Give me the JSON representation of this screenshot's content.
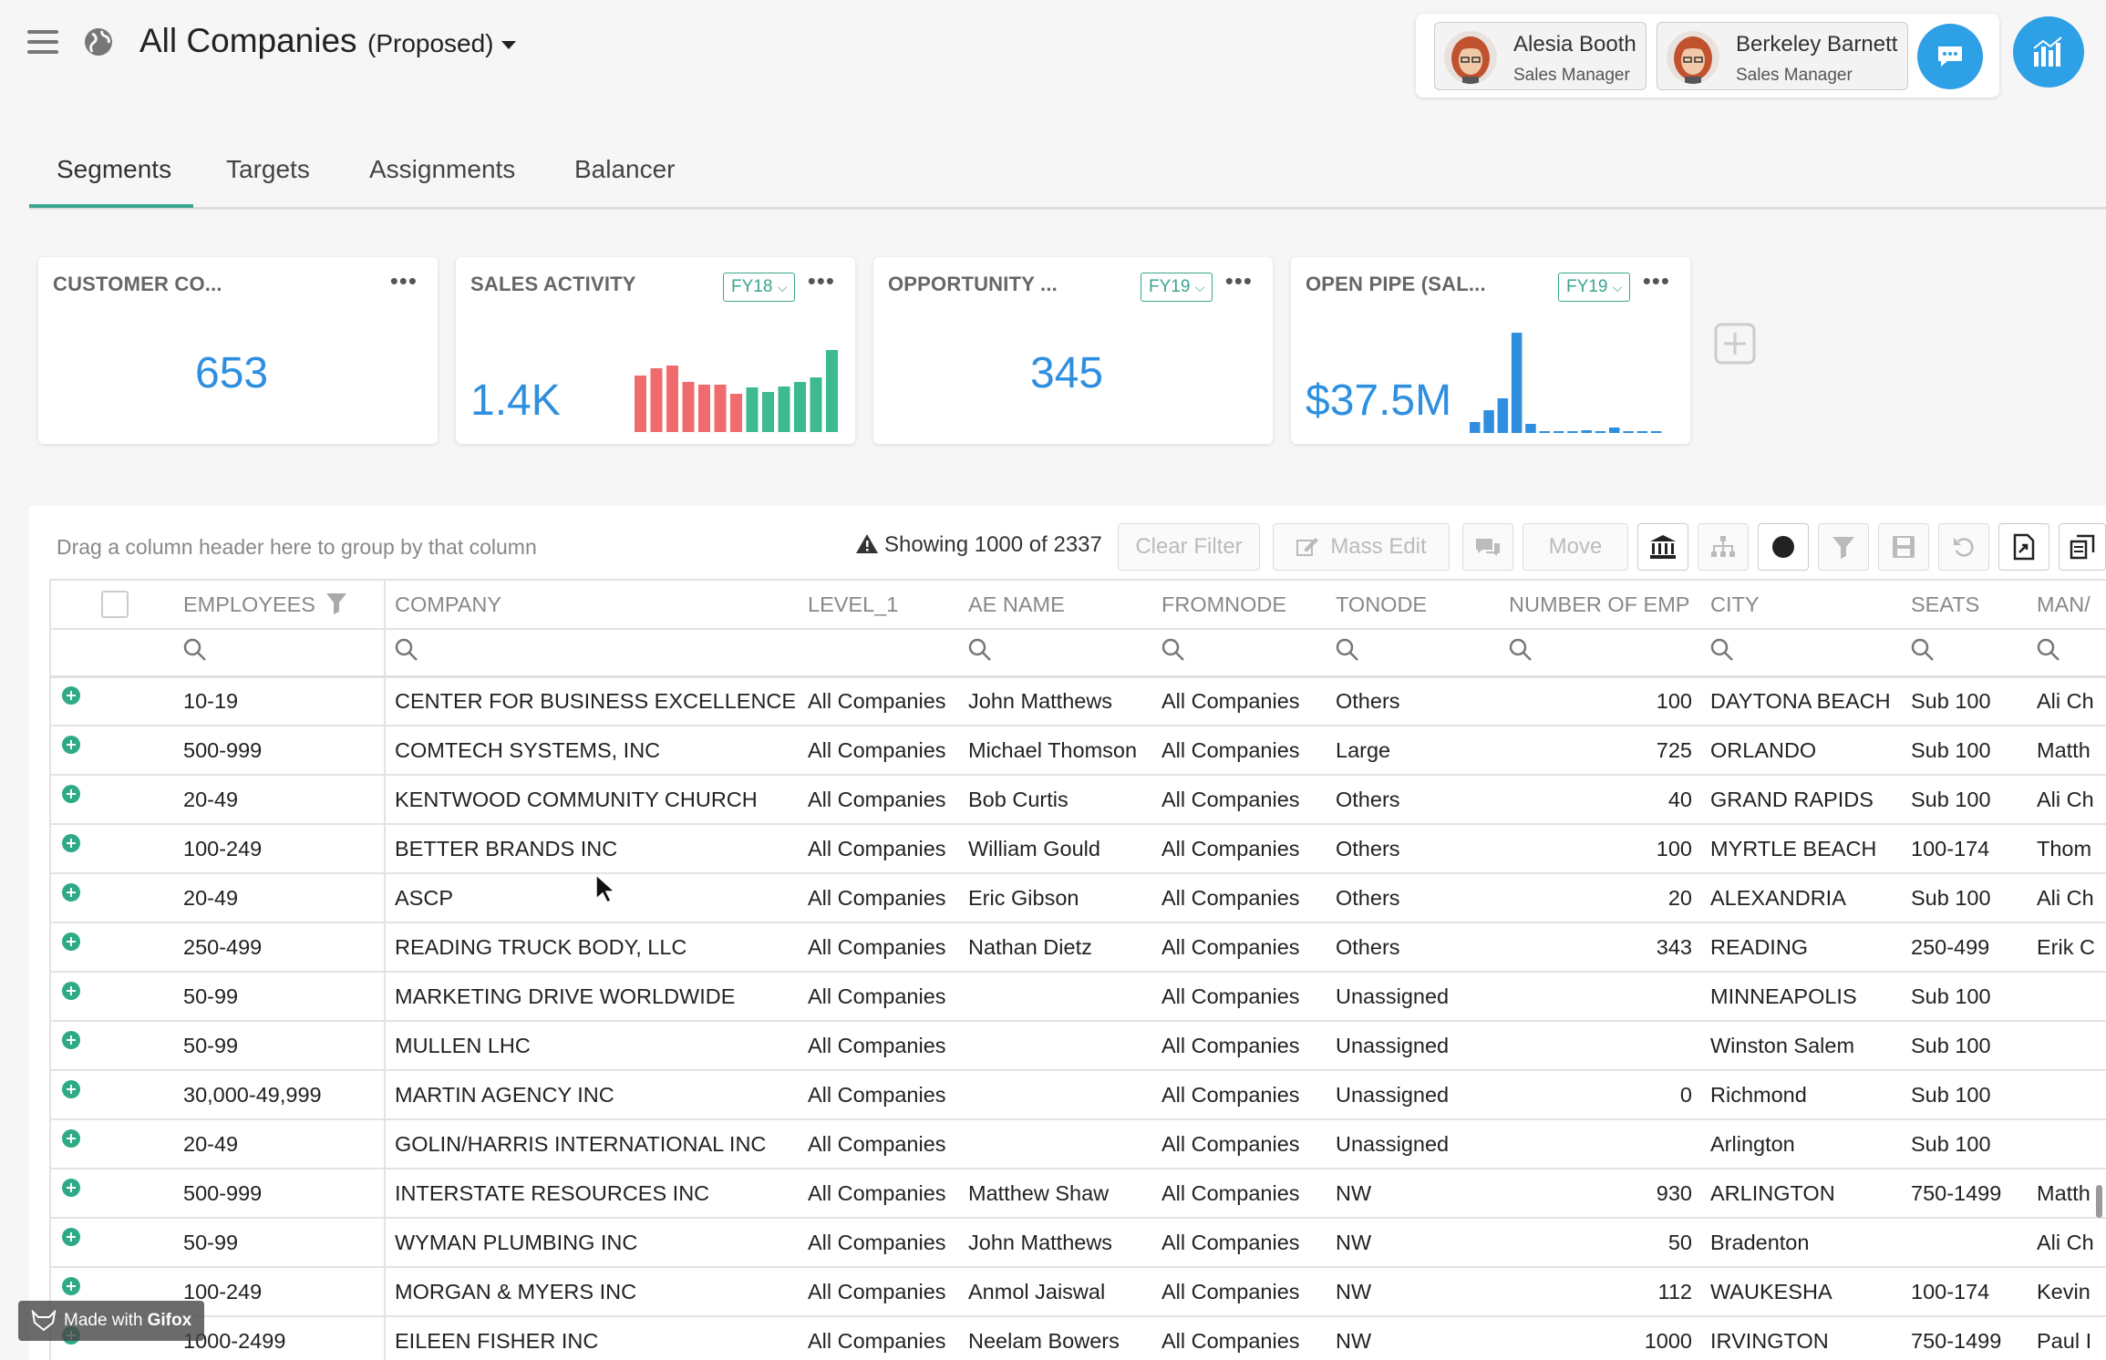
{
  "header": {
    "title": "All Companies",
    "scenario": "(Proposed)",
    "users": [
      {
        "name": "Alesia Booth",
        "role": "Sales Manager"
      },
      {
        "name": "Berkeley Barnett",
        "role": "Sales Manager"
      }
    ]
  },
  "tabs": [
    "Segments",
    "Targets",
    "Assignments",
    "Balancer"
  ],
  "active_tab": "Segments",
  "cards": [
    {
      "title": "CUSTOMER CO...",
      "value": "653",
      "fy": ""
    },
    {
      "title": "SALES ACTIVITY",
      "value": "1.4K",
      "fy": "FY18"
    },
    {
      "title": "OPPORTUNITY ...",
      "value": "345",
      "fy": "FY19"
    },
    {
      "title": "OPEN PIPE (SAL...",
      "value": "$37.5M",
      "fy": "FY19"
    }
  ],
  "sparklines": {
    "sales_activity": {
      "colors": [
        "#f06b6b",
        "#f06b6b",
        "#f06b6b",
        "#f06b6b",
        "#f06b6b",
        "#f06b6b",
        "#f06b6b",
        "#3dbb8f",
        "#3dbb8f",
        "#3dbb8f",
        "#3dbb8f",
        "#3dbb8f",
        "#3dbb8f"
      ],
      "values": [
        62,
        70,
        73,
        55,
        52,
        52,
        42,
        49,
        44,
        50,
        55,
        60,
        90
      ]
    },
    "open_pipe": {
      "color": "#2e8fe0",
      "values": [
        12,
        25,
        38,
        110,
        10,
        1,
        1,
        1,
        3,
        1,
        6,
        1,
        1,
        1
      ]
    }
  },
  "toolbar": {
    "group_hint": "Drag a column header here to group by that column",
    "showing": "Showing 1000 of 2337",
    "clear_filter": "Clear Filter",
    "mass_edit": "Mass Edit",
    "move": "Move"
  },
  "table": {
    "columns": [
      "EMPLOYEES",
      "COMPANY",
      "LEVEL_1",
      "AE NAME",
      "FROMNODE",
      "TONODE",
      "NUMBER OF EMP",
      "CITY",
      "SEATS",
      "MAN/"
    ],
    "rows": [
      [
        "10-19",
        "CENTER FOR BUSINESS EXCELLENCE",
        "All Companies",
        "John Matthews",
        "All Companies",
        "Others",
        "100",
        "DAYTONA BEACH",
        "Sub 100",
        "Ali Ch"
      ],
      [
        "500-999",
        "COMTECH SYSTEMS, INC",
        "All Companies",
        "Michael Thomson",
        "All Companies",
        "Large",
        "725",
        "ORLANDO",
        "Sub 100",
        "Matth"
      ],
      [
        "20-49",
        "KENTWOOD COMMUNITY CHURCH",
        "All Companies",
        "Bob Curtis",
        "All Companies",
        "Others",
        "40",
        "GRAND RAPIDS",
        "Sub 100",
        "Ali Ch"
      ],
      [
        "100-249",
        "BETTER BRANDS INC",
        "All Companies",
        "William Gould",
        "All Companies",
        "Others",
        "100",
        "MYRTLE BEACH",
        "100-174",
        "Thom"
      ],
      [
        "20-49",
        "ASCP",
        "All Companies",
        "Eric Gibson",
        "All Companies",
        "Others",
        "20",
        "ALEXANDRIA",
        "Sub 100",
        "Ali Ch"
      ],
      [
        "250-499",
        "READING TRUCK BODY, LLC",
        "All Companies",
        "Nathan Dietz",
        "All Companies",
        "Others",
        "343",
        "READING",
        "250-499",
        "Erik C"
      ],
      [
        "50-99",
        "MARKETING DRIVE WORLDWIDE",
        "All Companies",
        "",
        "All Companies",
        "Unassigned",
        "",
        "MINNEAPOLIS",
        "Sub 100",
        ""
      ],
      [
        "50-99",
        "MULLEN LHC",
        "All Companies",
        "",
        "All Companies",
        "Unassigned",
        "",
        "Winston Salem",
        "Sub 100",
        ""
      ],
      [
        "30,000-49,999",
        "MARTIN AGENCY INC",
        "All Companies",
        "",
        "All Companies",
        "Unassigned",
        "0",
        "Richmond",
        "Sub 100",
        ""
      ],
      [
        "20-49",
        "GOLIN/HARRIS INTERNATIONAL INC",
        "All Companies",
        "",
        "All Companies",
        "Unassigned",
        "",
        "Arlington",
        "Sub 100",
        ""
      ],
      [
        "500-999",
        "INTERSTATE RESOURCES INC",
        "All Companies",
        "Matthew Shaw",
        "All Companies",
        "NW",
        "930",
        "ARLINGTON",
        "750-1499",
        "Matth"
      ],
      [
        "50-99",
        "WYMAN PLUMBING INC",
        "All Companies",
        "John Matthews",
        "All Companies",
        "NW",
        "50",
        "Bradenton",
        "",
        "Ali Ch"
      ],
      [
        "100-249",
        "MORGAN & MYERS INC",
        "All Companies",
        "Anmol Jaiswal",
        "All Companies",
        "NW",
        "112",
        "WAUKESHA",
        "100-174",
        "Kevin"
      ],
      [
        "1000-2499",
        "EILEEN FISHER INC",
        "All Companies",
        "Neelam Bowers",
        "All Companies",
        "NW",
        "1000",
        "IRVINGTON",
        "750-1499",
        "Paul I"
      ]
    ]
  },
  "watermark": {
    "prefix": "Made with",
    "brand": "Gifox"
  }
}
